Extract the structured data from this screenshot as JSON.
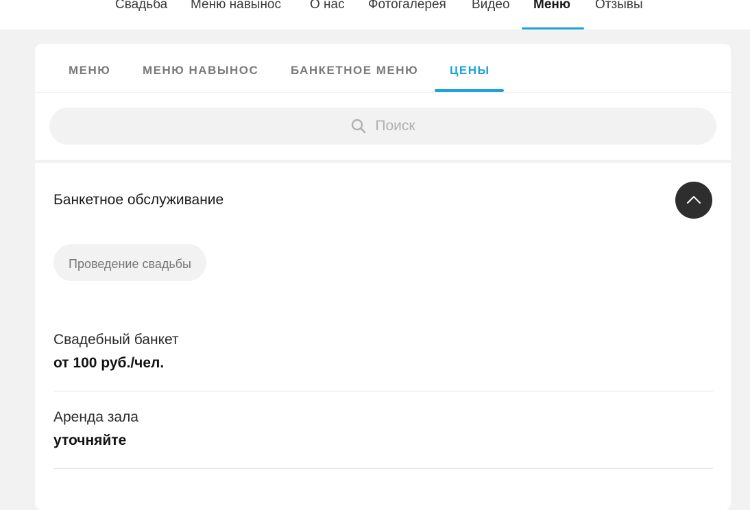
{
  "topnav": {
    "items": [
      "Свадьба",
      "Меню навынос",
      "О нас",
      "Фотогалерея",
      "Видео",
      "Меню",
      "Отзывы"
    ],
    "active": "Меню",
    "accent_color": "#1ea3d8"
  },
  "tabs": {
    "items": [
      "МЕНЮ",
      "МЕНЮ НАВЫНОС",
      "БАНКЕТНОЕ МЕНЮ",
      "ЦЕНЫ"
    ],
    "active": "ЦЕНЫ"
  },
  "search": {
    "placeholder": "Поиск",
    "icon": "search-icon"
  },
  "section": {
    "title": "Банкетное обслуживание",
    "toggle_icon": "chevron-up-icon",
    "chip": "Проведение свадьбы"
  },
  "prices": [
    {
      "name": "Свадебный банкет",
      "value": "от 100 руб./чел."
    },
    {
      "name": "Аренда зала",
      "value": "уточняйте"
    }
  ]
}
